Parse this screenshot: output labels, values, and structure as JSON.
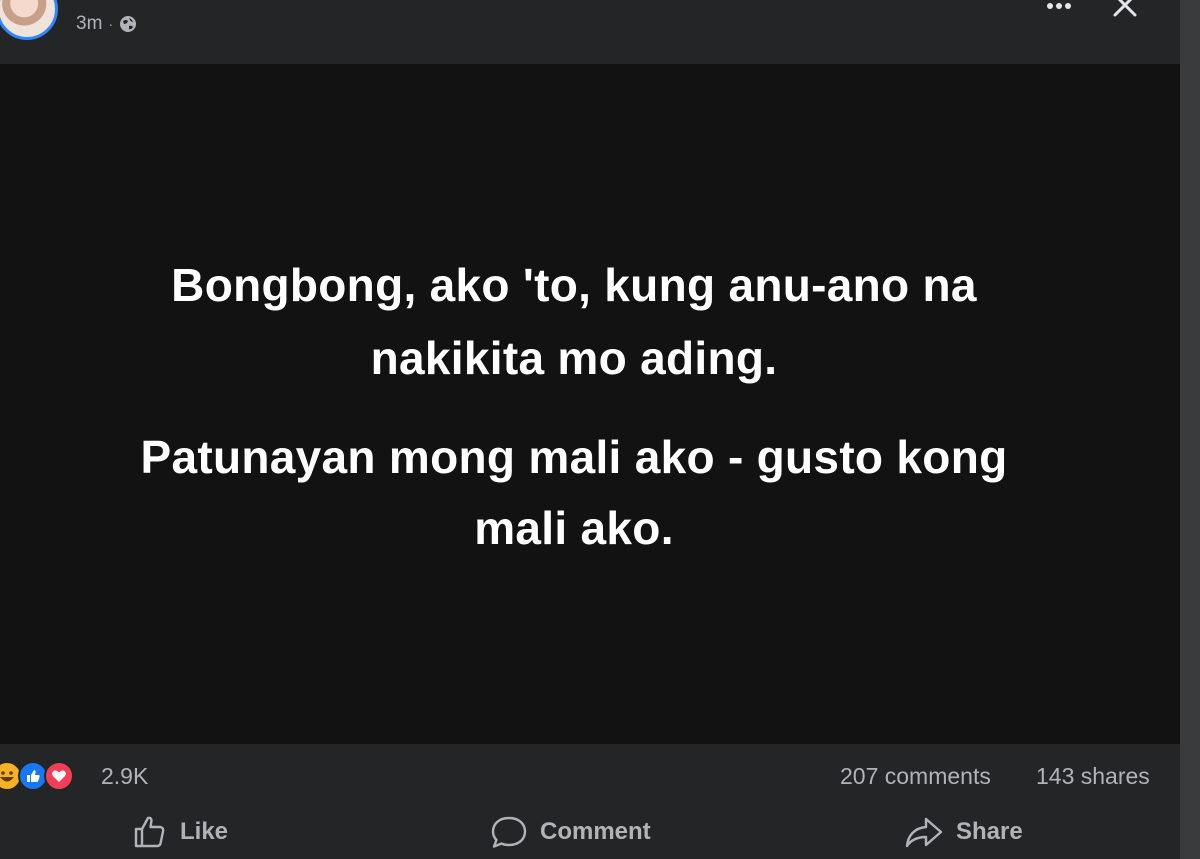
{
  "post": {
    "timestamp": "3m",
    "separator": "·",
    "privacy_icon": "globe-icon",
    "lines": [
      "Bongbong, ako 'to, kung anu-ano na",
      "nakikita mo ading.",
      "Patunayan mong mali ako - gusto kong",
      "mali ako."
    ],
    "background_color": "#121212"
  },
  "stats": {
    "reaction_icons": [
      "haha-reaction-icon",
      "like-reaction-icon",
      "love-reaction-icon"
    ],
    "reactions_count": "2.9K",
    "comments": "207 comments",
    "shares": "143 shares"
  },
  "actions": {
    "like_label": "Like",
    "comment_label": "Comment",
    "share_label": "Share"
  },
  "colors": {
    "accent": "#2d88ff",
    "like_blue": "#1877f2",
    "love_red": "#f33e58",
    "haha_yellow": "#f7b125",
    "secondary_text": "#b0b3b8"
  }
}
